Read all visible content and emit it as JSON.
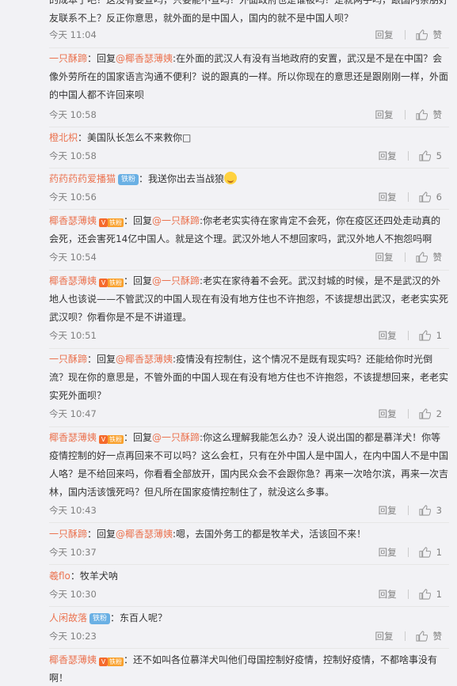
{
  "ui": {
    "reply": "回复",
    "like": "赞"
  },
  "comments": [
    {
      "text": "的成本了吧？这没有要查吗，只要能不查吗？外面政府也是谁被吗？是就两手吗，跟国内亲朋好友联系不上？反正你意思，就外面的是中国人，国内的就不是中国人呗？",
      "time": "今天 11:04",
      "likes": "赞"
    },
    {
      "user": "一只酥蹄",
      "sep": "：回复",
      "mention": "@椰香瑟薄姨",
      "text": ":在外面的武汉人有没有当地政府的安置，武汉是不是在中国？会像外劳所在的国家语言沟通不便利？说的跟真的一样。所以你现在的意思还是跟刚刚一样，外面的中国人都不许回来呗",
      "time": "今天 10:58",
      "likes": "赞"
    },
    {
      "user": "橙北枳",
      "text": "：美国队长怎么不来救你□",
      "time": "今天 10:58",
      "likes": "5"
    },
    {
      "user": "药药药药爱播猫",
      "badge": "铁粉",
      "text": "：我送你出去当战狼",
      "time": "今天 10:56",
      "likes": "6"
    },
    {
      "user": "椰香瑟薄姨",
      "vbadge": "铁粉",
      "sep": "：回复",
      "mention": "@一只酥蹄",
      "text": ":你老老实实待在家肯定不会死，你在疫区还四处走动真的会死，还会害死14亿中国人。就是这个理。武汉外地人不想回家吗，武汉外地人不抱怨吗啊",
      "time": "今天 10:54",
      "likes": "赞"
    },
    {
      "user": "椰香瑟薄姨",
      "vbadge": "铁粉",
      "sep": "：回复",
      "mention": "@一只酥蹄",
      "text": ":老实在家待着不会死。武汉封城的时候，是不是武汉的外地人也该说——不管武汉的中国人现在有没有地方住也不许抱怨，不该提想出武汉，老老实实死武汉呗？你看你是不是不讲道理。",
      "time": "今天 10:51",
      "likes": "1"
    },
    {
      "user": "一只酥蹄",
      "sep": "：回复",
      "mention": "@椰香瑟薄姨",
      "text": ":疫情没有控制住，这个情况不是既有现实吗？还能给你时光倒流？现在你的意思是，不管外面的中国人现在有没有地方住也不许抱怨，不该提想回来，老老实实死外面呗？",
      "time": "今天 10:47",
      "likes": "2"
    },
    {
      "user": "椰香瑟薄姨",
      "vbadge": "铁粉",
      "sep": "：回复",
      "mention": "@一只酥蹄",
      "text": ":你这么理解我能怎么办？没人说出国的都是慕洋犬！你等疫情控制的好一点再回来不可以吗？这么会杠，只有在外中国人是中国人，在内中国人不是中国人咯？是不给回来吗，你看看全部放开，国内民众会不会跟你急？再来一次哈尔滨，再来一次吉林，国内活该饿死吗？但凡所在国家疫情控制住了，就没这么多事。",
      "time": "今天 10:43",
      "likes": "3"
    },
    {
      "user": "一只酥蹄",
      "sep": "：回复",
      "mention": "@椰香瑟薄姨",
      "text": ":嗯，去国外务工的都是牧羊犬，活该回不来！",
      "time": "今天 10:37",
      "likes": "1"
    },
    {
      "user": "羲flo",
      "text": "：牧羊犬呐",
      "time": "今天 10:30",
      "likes": "1"
    },
    {
      "user": "人闲故落",
      "badge": "铁粉",
      "text": "：东百人呢？",
      "time": "今天 10:23",
      "likes": "赞"
    },
    {
      "user": "椰香瑟薄姨",
      "vbadge": "铁粉",
      "text": "：还不如叫各位慕洋犬叫他们母国控制好疫情，控制好疫情，不都啥事没有啊！",
      "time": "",
      "likes": ""
    }
  ]
}
